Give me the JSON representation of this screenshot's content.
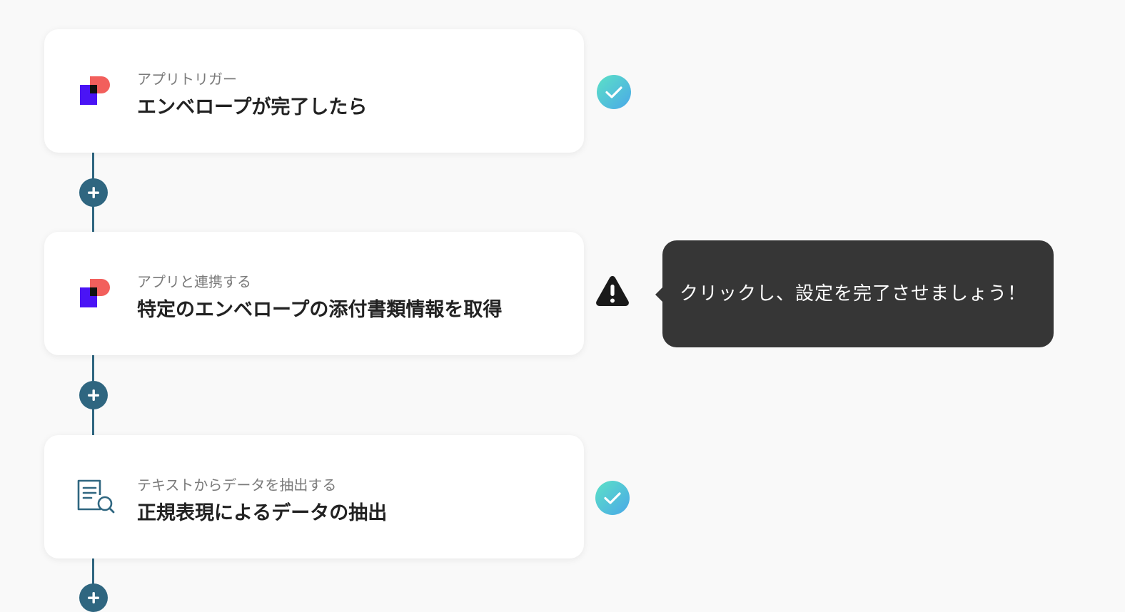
{
  "steps": [
    {
      "subtitle": "アプリトリガー",
      "title": "エンベロープが完了したら",
      "icon": "docusign-app-icon",
      "status": "complete"
    },
    {
      "subtitle": "アプリと連携する",
      "title": "特定のエンベロープの添付書類情報を取得",
      "icon": "docusign-app-icon",
      "status": "warning"
    },
    {
      "subtitle": "テキストからデータを抽出する",
      "title": "正規表現によるデータの抽出",
      "icon": "document-search-icon",
      "status": "complete"
    }
  ],
  "tooltip": {
    "text": "クリックし、設定を完了させましょう！"
  },
  "colors": {
    "background": "#f9f9f9",
    "connector": "#2f6680",
    "check_gradient_start": "#5ce1c6",
    "check_gradient_end": "#4aa8e8",
    "warning": "#1a1a1a",
    "tooltip_bg": "#363636",
    "brand_red": "#f25f5c",
    "brand_purple": "#4a14f5"
  }
}
